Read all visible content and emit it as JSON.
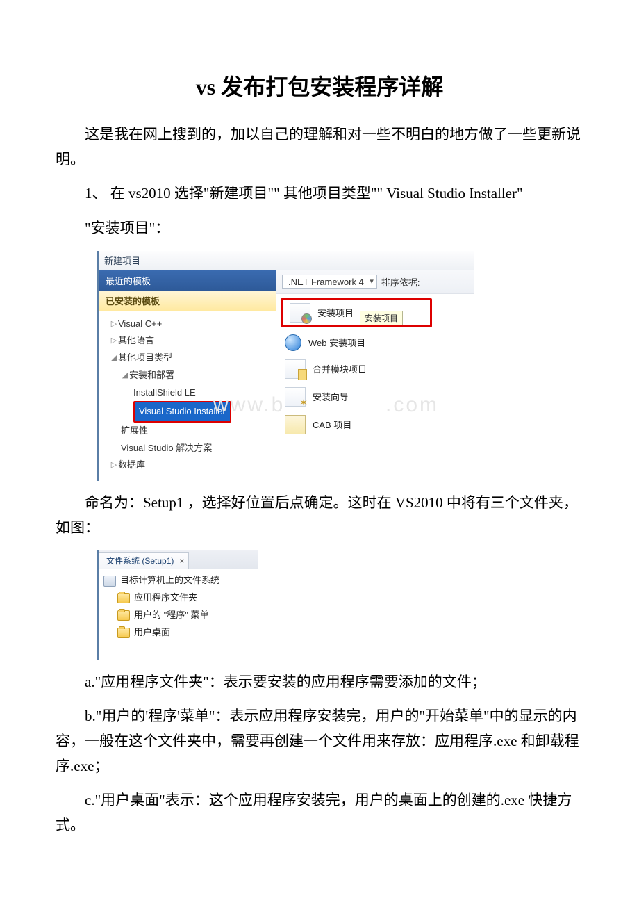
{
  "title": "vs 发布打包安装程序详解",
  "paragraphs": {
    "p1": "这是我在网上搜到的，加以自己的理解和对一些不明白的地方做了一些更新说明。",
    "p2_prefix": "1、 在 vs2010 选择\"新建项目\"\" 其他项目类型\"\" Visual Studio Installer\"",
    "p3": "\"安装项目\"：",
    "p4": "命名为：Setup1 ，选择好位置后点确定。这时在 VS2010 中将有三个文件夹，如图：",
    "pa": "a.\"应用程序文件夹\"：表示要安装的应用程序需要添加的文件；",
    "pb": "b.\"用户的'程序'菜单\"：表示应用程序安装完，用户的\"开始菜单\"中的显示的内容，一般在这个文件夹中，需要再创建一个文件用来存放：应用程序.exe 和卸载程序.exe；",
    "pc": "c.\"用户桌面\"表示：这个应用程序安装完，用户的桌面上的创建的.exe 快捷方式。"
  },
  "dialog1": {
    "title": "新建项目",
    "recent_templates": "最近的模板",
    "installed_templates": "已安装的模板",
    "framework_combo": ".NET Framework 4",
    "sort_label": "排序依据:",
    "tree": {
      "visual_cpp": "Visual C++",
      "other_lang": "其他语言",
      "other_types": "其他项目类型",
      "setup_deploy": "安装和部署",
      "installshield": "InstallShield LE",
      "vs_installer": "Visual Studio Installer",
      "extensibility": "扩展性",
      "vs_solution": "Visual Studio 解决方案",
      "database": "数据库"
    },
    "items": {
      "setup_project": "安装项目",
      "web_setup": "Web 安装项目",
      "merge_module": "合并模块项目",
      "setup_wizard": "安装向导",
      "cab_project": "CAB 项目"
    },
    "tooltip": "安装项目",
    "watermark_left": "www.b",
    "watermark_right": ".com"
  },
  "dialog2": {
    "tab": "文件系统 (Setup1)",
    "root": "目标计算机上的文件系统",
    "folders": {
      "app": "应用程序文件夹",
      "menu": "用户的 \"程序\" 菜单",
      "desktop": "用户桌面"
    }
  }
}
